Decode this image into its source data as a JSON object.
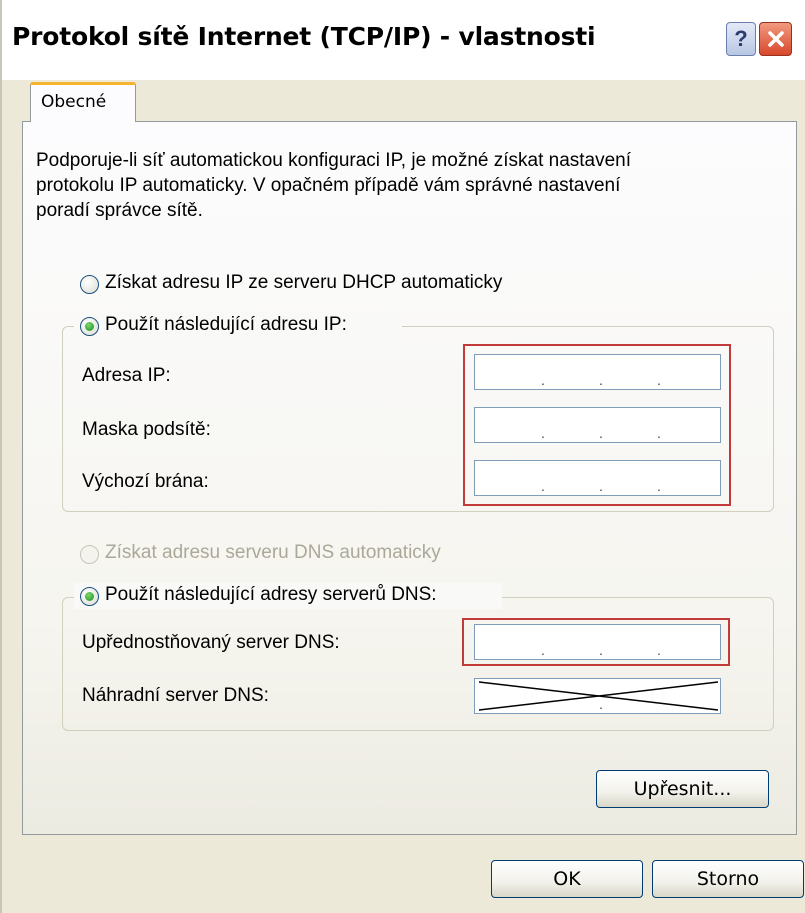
{
  "window": {
    "title": "Protokol sítě Internet (TCP/IP) - vlastnosti",
    "help_label": "?"
  },
  "tabs": [
    {
      "label": "Obecné",
      "selected": true
    }
  ],
  "general": {
    "intro": "Podporuje-li síť automatickou konfiguraci IP, je možné získat nastavení\nprotokolu IP automaticky. V opačném případě vám správné nastavení\nporadí správce sítě.",
    "ip_mode": {
      "auto_label": "Získat adresu IP ze serveru DHCP automaticky",
      "manual_label": "Použít následující adresu IP:",
      "selected": "manual"
    },
    "ip_fields": [
      {
        "label": "Adresa IP:",
        "value": ""
      },
      {
        "label": "Maska podsítě:",
        "value": ""
      },
      {
        "label": "Výchozí brána:",
        "value": ""
      }
    ],
    "dns_mode": {
      "auto_label": "Získat adresu serveru DNS automaticky",
      "auto_disabled": true,
      "manual_label": "Použít následující adresy serverů DNS:",
      "selected": "manual"
    },
    "dns_fields": [
      {
        "label": "Upřednostňovaný server DNS:",
        "value": ""
      },
      {
        "label": "Náhradní server DNS:",
        "value": "",
        "crossed_out": true
      }
    ],
    "advanced_button": "Upřesnit..."
  },
  "footer": {
    "ok_label": "OK",
    "cancel_label": "Storno"
  },
  "colors": {
    "dialog_bg": "#ece9d8",
    "tab_accent": "#f5b42f",
    "highlight_box": "#c33a3a",
    "close_button": "#d8472b",
    "radio_checked": "#1f8c1e"
  },
  "icons": {
    "help": "help-icon",
    "close": "close-icon"
  }
}
